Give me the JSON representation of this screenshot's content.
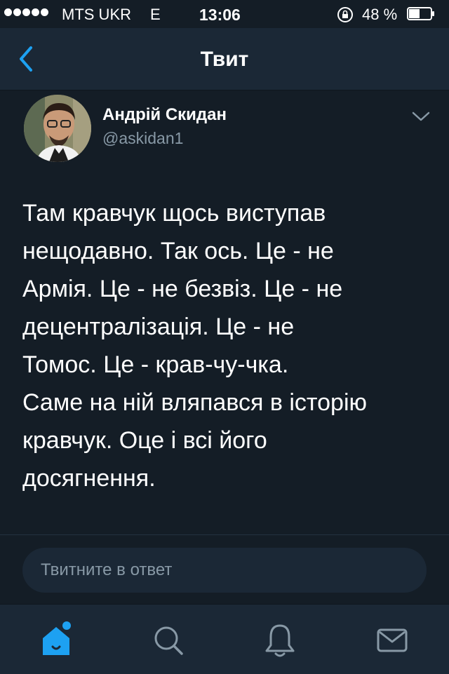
{
  "status_bar": {
    "carrier": "MTS UKR",
    "network": "E",
    "time": "13:06",
    "battery_percent": "48 %",
    "signal_bars": 5
  },
  "nav": {
    "title": "Твит",
    "back_icon": "chevron-left-icon"
  },
  "tweet": {
    "author_name": "Андрій Скидан",
    "author_handle": "@askidan1",
    "text": "Там кравчук щось виступав\nнещодавно. Так ось. Це - не\nАрмія. Це - не безвіз. Це - не\nдецентралізація. Це - не\nТомос. Це - крав-чу-чка.\nСаме на ній вляпався в історію\nкравчук. Оце і всі його\nдосягнення."
  },
  "reply": {
    "placeholder": "Твитните в ответ"
  },
  "tabs": [
    {
      "icon": "home-icon",
      "active": true
    },
    {
      "icon": "search-icon",
      "active": false
    },
    {
      "icon": "notifications-icon",
      "active": false
    },
    {
      "icon": "messages-icon",
      "active": false
    }
  ],
  "colors": {
    "background": "#141d26",
    "bar": "#1b2836",
    "accent": "#1da1f2",
    "secondary_text": "#8899a6"
  }
}
